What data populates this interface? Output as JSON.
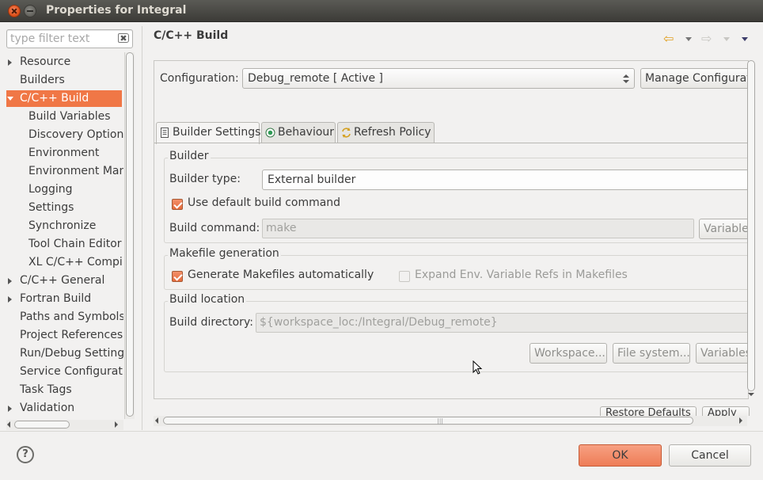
{
  "window": {
    "title": "Properties for Integral"
  },
  "filter": {
    "placeholder": "type filter text",
    "clear_icon": "✖"
  },
  "tree": {
    "items": [
      {
        "label": "Resource",
        "twisty": "closed",
        "indent": 0
      },
      {
        "label": "Builders",
        "twisty": "",
        "indent": 0
      },
      {
        "label": "C/C++ Build",
        "twisty": "open",
        "indent": 0,
        "selected": true
      },
      {
        "label": "Build Variables",
        "twisty": "",
        "indent": 1
      },
      {
        "label": "Discovery Options",
        "twisty": "",
        "indent": 1
      },
      {
        "label": "Environment",
        "twisty": "",
        "indent": 1
      },
      {
        "label": "Environment Man",
        "twisty": "",
        "indent": 1
      },
      {
        "label": "Logging",
        "twisty": "",
        "indent": 1
      },
      {
        "label": "Settings",
        "twisty": "",
        "indent": 1
      },
      {
        "label": "Synchronize",
        "twisty": "",
        "indent": 1
      },
      {
        "label": "Tool Chain Editor",
        "twisty": "",
        "indent": 1
      },
      {
        "label": "XL C/C++ Compile",
        "twisty": "",
        "indent": 1
      },
      {
        "label": "C/C++ General",
        "twisty": "closed",
        "indent": 0
      },
      {
        "label": "Fortran Build",
        "twisty": "closed",
        "indent": 0
      },
      {
        "label": "Paths and Symbols",
        "twisty": "",
        "indent": 0
      },
      {
        "label": "Project References",
        "twisty": "",
        "indent": 0
      },
      {
        "label": "Run/Debug Settings",
        "twisty": "",
        "indent": 0
      },
      {
        "label": "Service Configurati",
        "twisty": "",
        "indent": 0
      },
      {
        "label": "Task Tags",
        "twisty": "",
        "indent": 0
      },
      {
        "label": "Validation",
        "twisty": "closed",
        "indent": 0
      }
    ]
  },
  "header": {
    "title": "C/C++ Build",
    "back_icon": "⇦",
    "forward_icon": "⇨"
  },
  "config": {
    "label": "Configuration:",
    "value": "Debug_remote  [ Active ]",
    "manage_button": "Manage Configurations..."
  },
  "tabs": [
    {
      "label": "Builder Settings",
      "icon": "document-icon",
      "active": true
    },
    {
      "label": "Behaviour",
      "icon": "radio-icon",
      "active": false
    },
    {
      "label": "Refresh Policy",
      "icon": "refresh-icon",
      "active": false
    }
  ],
  "builder": {
    "group_title": "Builder",
    "type_label": "Builder type:",
    "type_value": "External builder",
    "use_default_label": "Use default build command",
    "use_default_checked": true,
    "command_label": "Build command:",
    "command_value": "make",
    "variables_button": "Variables..."
  },
  "makefile": {
    "group_title": "Makefile generation",
    "generate_label": "Generate Makefiles automatically",
    "generate_checked": true,
    "expand_label": "Expand Env. Variable Refs in Makefiles",
    "expand_checked": false
  },
  "location": {
    "group_title": "Build location",
    "directory_label": "Build directory:",
    "directory_value": "${workspace_loc:/Integral/Debug_remote}",
    "workspace_button": "Workspace...",
    "filesystem_button": "File system...",
    "variables_button": "Variables..."
  },
  "footer_cut": {
    "restore_button": "Restore Defaults",
    "apply_button": "Apply"
  },
  "footer": {
    "help_icon": "?",
    "ok_button": "OK",
    "cancel_button": "Cancel"
  },
  "colors": {
    "accent": "#f07746",
    "ok_button": "#ee7d57",
    "title_bar": "#3c3b37"
  }
}
